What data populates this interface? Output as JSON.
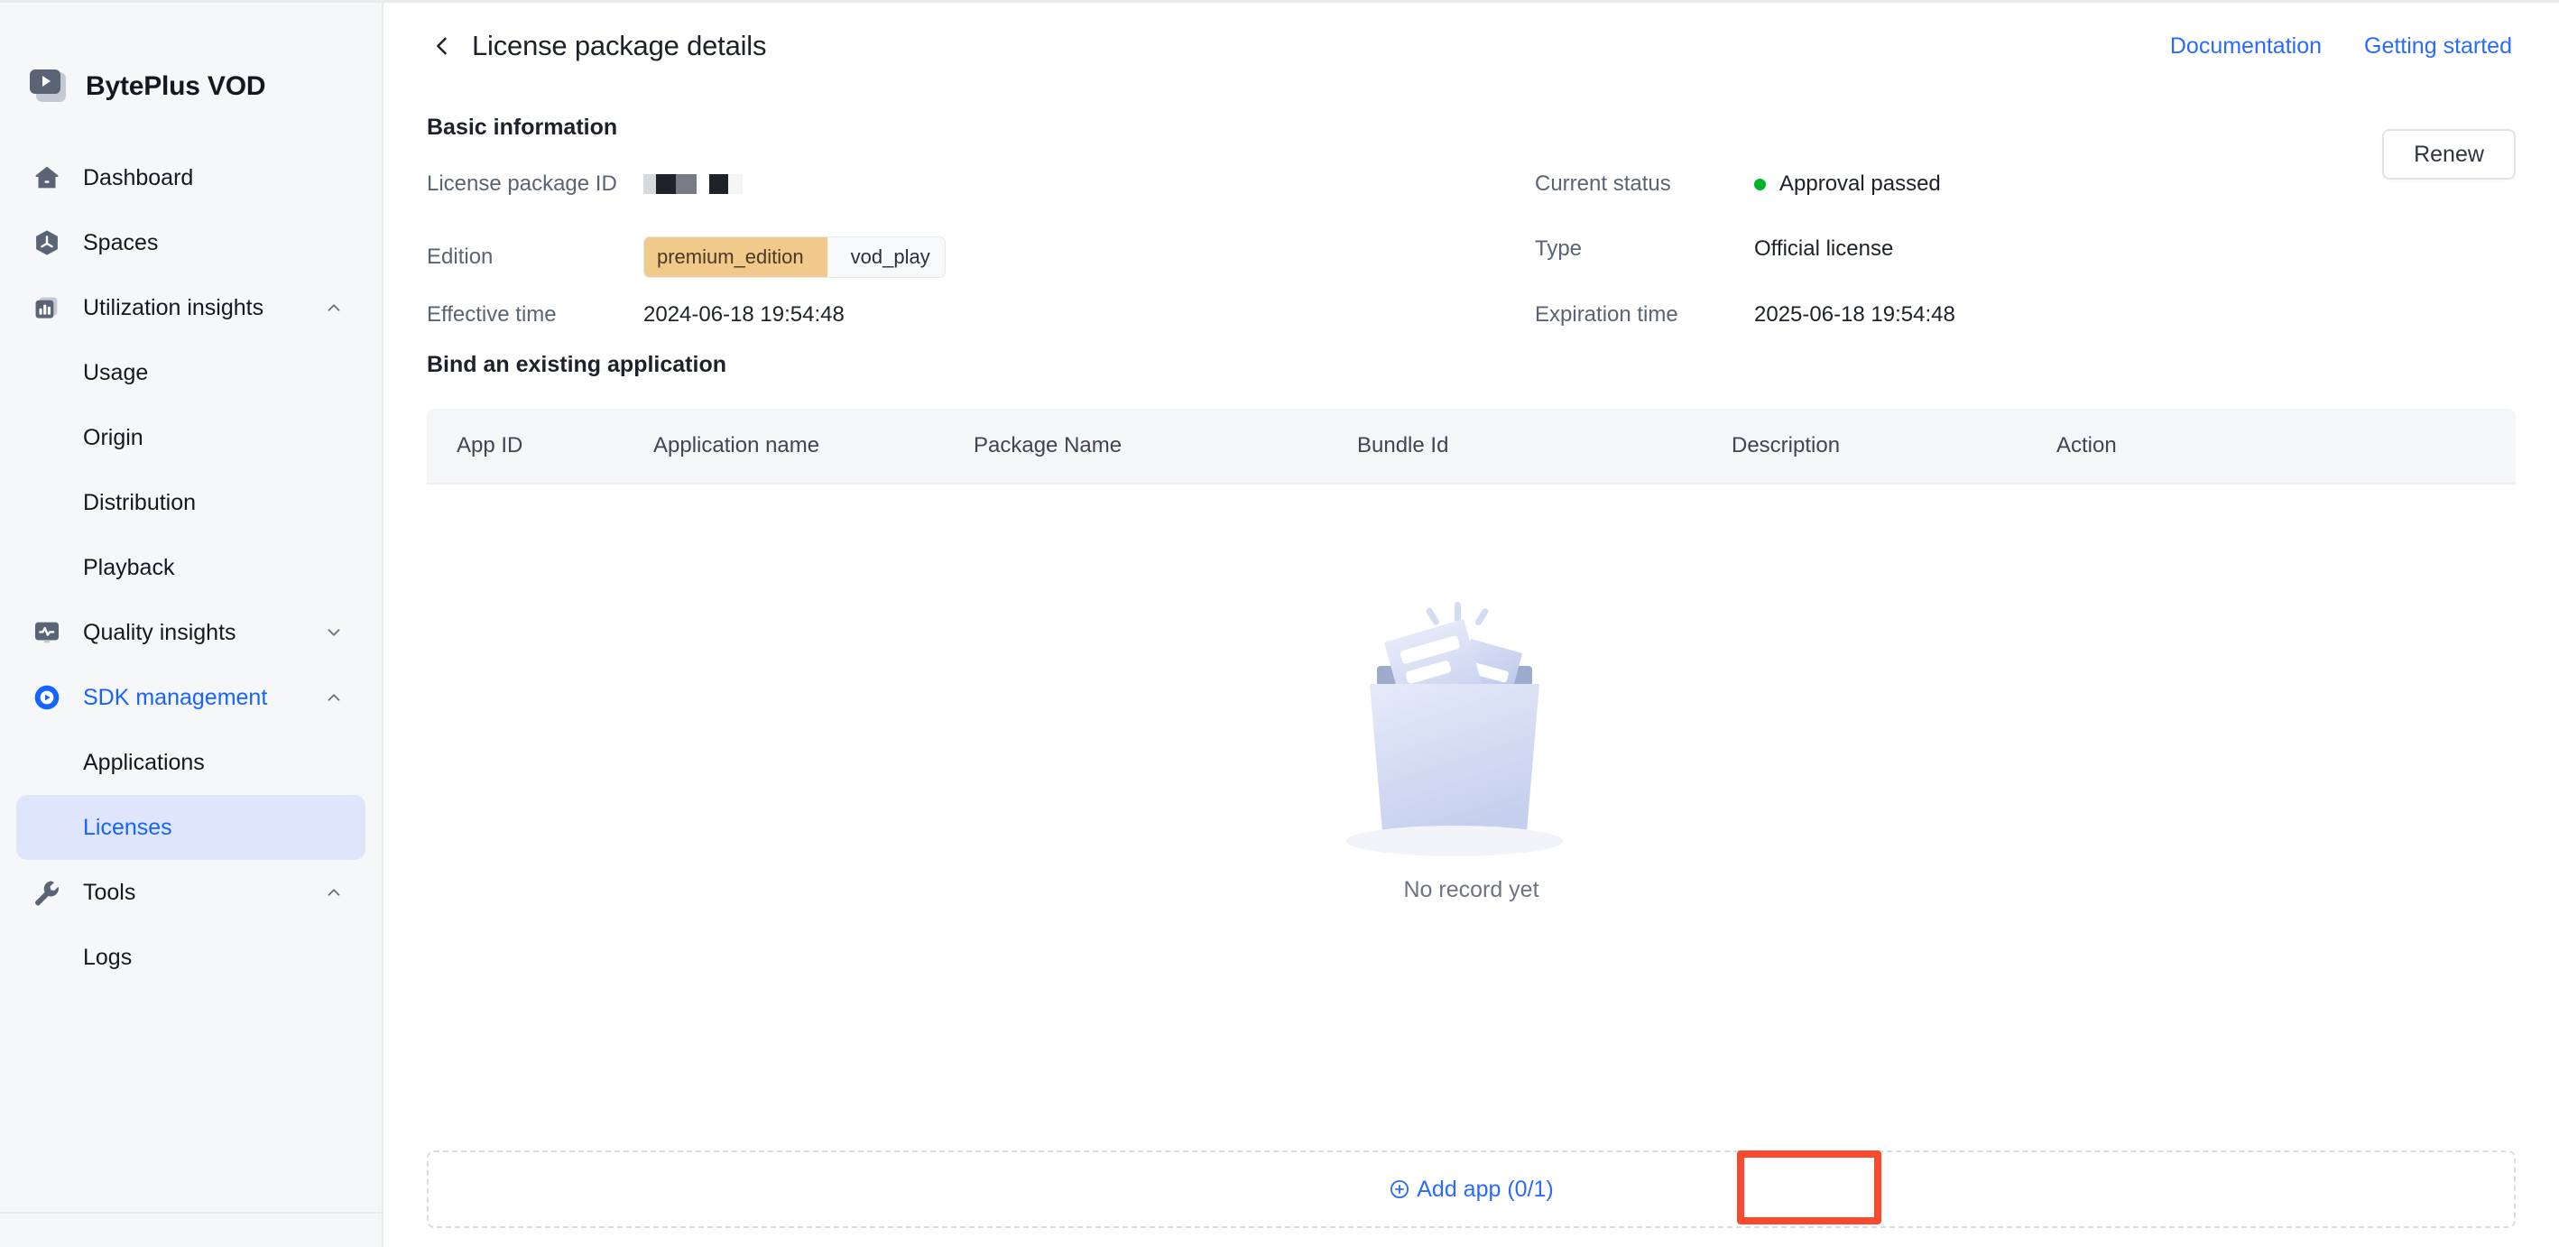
{
  "sidebar": {
    "brand": {
      "name": "BytePlus VOD",
      "icon": "video-play-icon"
    },
    "items": [
      {
        "label": "Dashboard",
        "icon": "home-icon",
        "level": "top",
        "state": "default",
        "chevron": ""
      },
      {
        "label": "Spaces",
        "icon": "spaces-icon",
        "level": "top",
        "state": "default",
        "chevron": ""
      },
      {
        "label": "Utilization insights",
        "icon": "bar-chart-icon",
        "level": "top",
        "state": "default",
        "chevron": "up"
      },
      {
        "label": "Usage",
        "icon": "",
        "level": "sub",
        "state": "default",
        "chevron": ""
      },
      {
        "label": "Origin",
        "icon": "",
        "level": "sub",
        "state": "default",
        "chevron": ""
      },
      {
        "label": "Distribution",
        "icon": "",
        "level": "sub",
        "state": "default",
        "chevron": ""
      },
      {
        "label": "Playback",
        "icon": "",
        "level": "sub",
        "state": "default",
        "chevron": ""
      },
      {
        "label": "Quality insights",
        "icon": "monitor-pulse-icon",
        "level": "top",
        "state": "default",
        "chevron": "down"
      },
      {
        "label": "SDK management",
        "icon": "sdk-play-circle-icon",
        "level": "top",
        "state": "open-parent",
        "chevron": "up"
      },
      {
        "label": "Applications",
        "icon": "",
        "level": "sub",
        "state": "default",
        "chevron": ""
      },
      {
        "label": "Licenses",
        "icon": "",
        "level": "sub",
        "state": "active",
        "chevron": ""
      },
      {
        "label": "Tools",
        "icon": "wrench-icon",
        "level": "top",
        "state": "default",
        "chevron": "up"
      },
      {
        "label": "Logs",
        "icon": "",
        "level": "sub",
        "state": "default",
        "chevron": ""
      }
    ]
  },
  "header": {
    "back_icon": "chevron-left-icon",
    "title": "License package details",
    "links": [
      {
        "label": "Documentation"
      },
      {
        "label": "Getting started"
      }
    ]
  },
  "basic_information": {
    "section_title": "Basic information",
    "renew_button": "Renew",
    "fields": {
      "license_package_id_label": "License package ID",
      "license_package_id_value": "",
      "edition_label": "Edition",
      "edition_primary": "premium_edition",
      "edition_secondary": "vod_play",
      "effective_time_label": "Effective time",
      "effective_time_value": "2024-06-18 19:54:48",
      "current_status_label": "Current status",
      "current_status_value": "Approval passed",
      "type_label": "Type",
      "type_value": "Official license",
      "expiration_time_label": "Expiration time",
      "expiration_time_value": "2025-06-18 19:54:48"
    }
  },
  "bind_section": {
    "section_title": "Bind an existing application",
    "columns": [
      "App ID",
      "Application name",
      "Package Name",
      "Bundle Id",
      "Description",
      "Action"
    ],
    "rows": [],
    "empty_text": "No record yet",
    "empty_illustration": "empty-box-documents-icon",
    "add_button": {
      "icon": "plus-circle-icon",
      "label": "Add app (0/1)"
    }
  },
  "colors": {
    "accent_blue": "#2a6aff",
    "sidebar_active_bg": "#dfe6fb",
    "status_green": "#00b42a",
    "edition_amber": "#f0c98b",
    "highlight_red": "#f9492f",
    "table_header_bg": "#f5f6f8",
    "sidebar_bg": "#f6f7f9"
  }
}
